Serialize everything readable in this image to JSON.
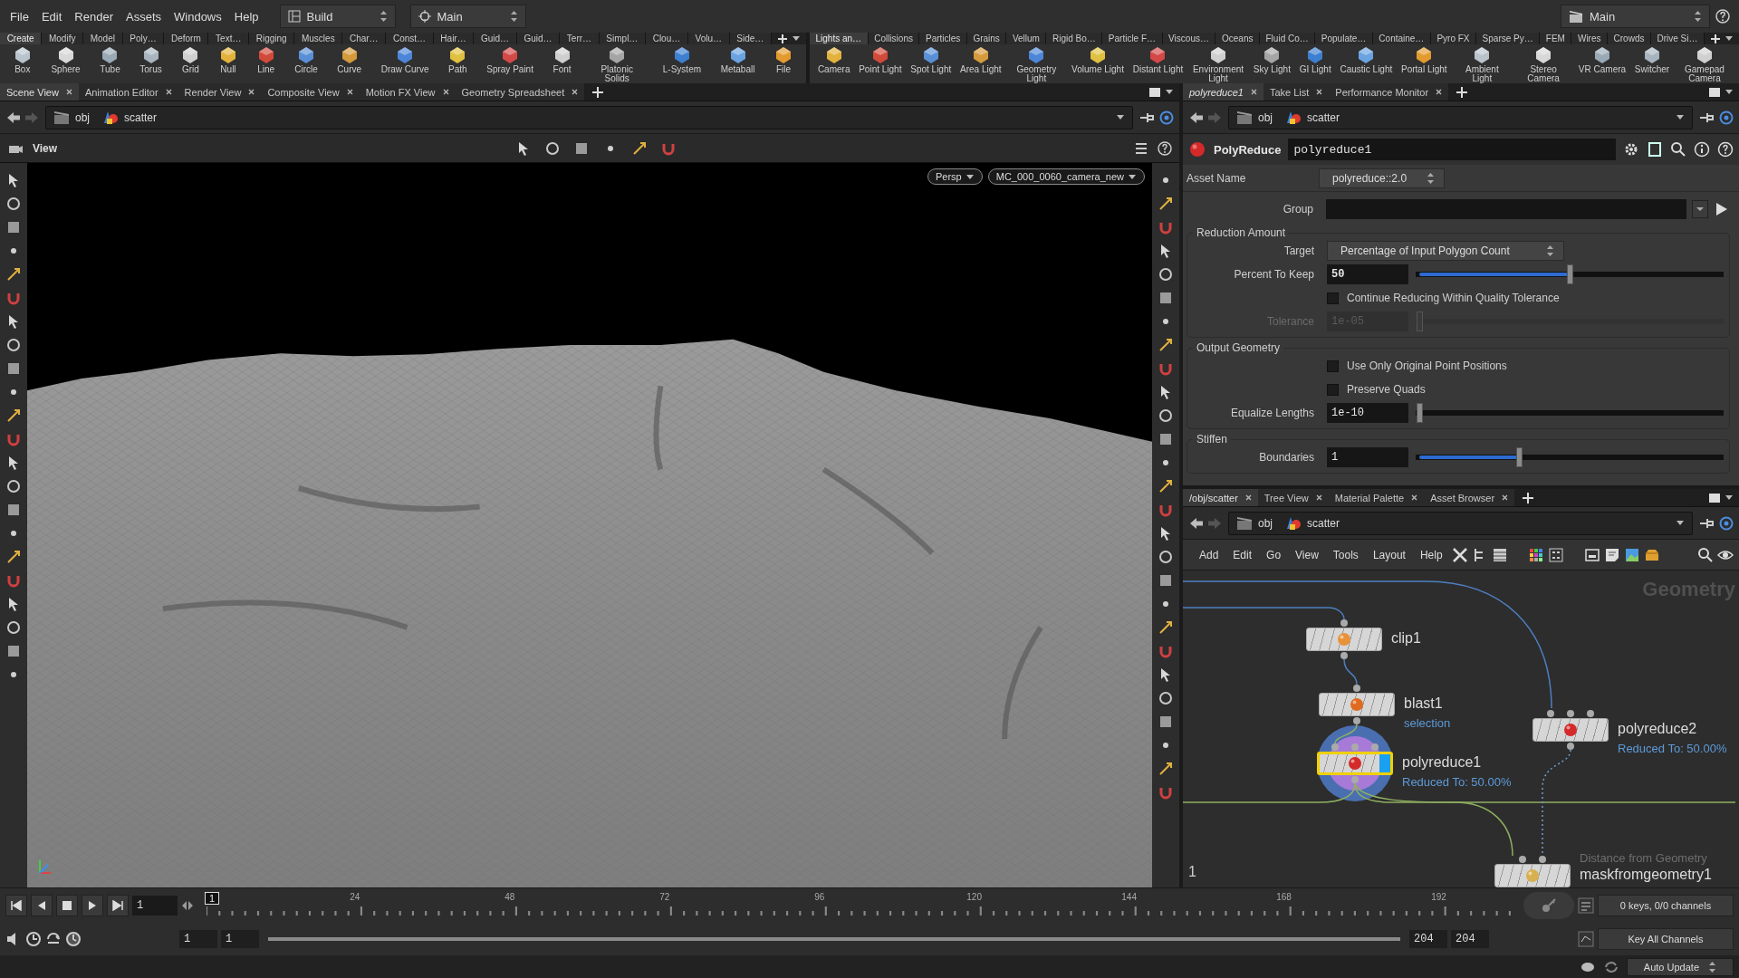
{
  "menu_bar": {
    "items": [
      "File",
      "Edit",
      "Render",
      "Assets",
      "Windows",
      "Help"
    ],
    "desktops": [
      "Build",
      "Main"
    ],
    "right_desktop": "Main"
  },
  "shelves": [
    {
      "tabs": [
        {
          "label": "Create",
          "selected": true
        },
        {
          "label": "Modify",
          "selected": false
        },
        {
          "label": "Model",
          "selected": false
        },
        {
          "label": "Poly…",
          "selected": false
        },
        {
          "label": "Deform",
          "selected": false
        },
        {
          "label": "Text…",
          "selected": false
        },
        {
          "label": "Rigging",
          "selected": false
        },
        {
          "label": "Muscles",
          "selected": false
        },
        {
          "label": "Char…",
          "selected": false
        },
        {
          "label": "Const…",
          "selected": false
        },
        {
          "label": "Hair…",
          "selected": false
        },
        {
          "label": "Guid…",
          "selected": false
        },
        {
          "label": "Guid…",
          "selected": false
        },
        {
          "label": "Terr…",
          "selected": false
        },
        {
          "label": "Simpl…",
          "selected": false
        },
        {
          "label": "Clou…",
          "selected": false
        },
        {
          "label": "Volu…",
          "selected": false
        },
        {
          "label": "Side…",
          "selected": false
        }
      ],
      "tools": [
        "Box",
        "Sphere",
        "Tube",
        "Torus",
        "Grid",
        "Null",
        "Line",
        "Circle",
        "Curve",
        "Draw Curve",
        "Path",
        "Spray Paint",
        "Font",
        "Platonic Solids",
        "L-System",
        "Metaball",
        "File"
      ]
    },
    {
      "tabs": [
        {
          "label": "Lights an…",
          "selected": true
        },
        {
          "label": "Collisions",
          "selected": false
        },
        {
          "label": "Particles",
          "selected": false
        },
        {
          "label": "Grains",
          "selected": false
        },
        {
          "label": "Vellum",
          "selected": false
        },
        {
          "label": "Rigid Bo…",
          "selected": false
        },
        {
          "label": "Particle F…",
          "selected": false
        },
        {
          "label": "Viscous…",
          "selected": false
        },
        {
          "label": "Oceans",
          "selected": false
        },
        {
          "label": "Fluid Co…",
          "selected": false
        },
        {
          "label": "Populate…",
          "selected": false
        },
        {
          "label": "Containe…",
          "selected": false
        },
        {
          "label": "Pyro FX",
          "selected": false
        },
        {
          "label": "Sparse Py…",
          "selected": false
        },
        {
          "label": "FEM",
          "selected": false
        },
        {
          "label": "Wires",
          "selected": false
        },
        {
          "label": "Crowds",
          "selected": false
        },
        {
          "label": "Drive Si…",
          "selected": false
        }
      ],
      "tools": [
        "Camera",
        "Point Light",
        "Spot Light",
        "Area Light",
        "Geometry Light",
        "Volume Light",
        "Distant Light",
        "Environment Light",
        "Sky Light",
        "GI Light",
        "Caustic Light",
        "Portal Light",
        "Ambient Light",
        "Stereo Camera",
        "VR Camera",
        "Switcher",
        "Gamepad Camera"
      ]
    }
  ],
  "scene_pane": {
    "tabs": [
      {
        "label": "Scene View",
        "selected": true
      },
      {
        "label": "Animation Editor",
        "selected": false
      },
      {
        "label": "Render View",
        "selected": false
      },
      {
        "label": "Composite View",
        "selected": false
      },
      {
        "label": "Motion FX View",
        "selected": false
      },
      {
        "label": "Geometry Spreadsheet",
        "selected": false
      }
    ],
    "path": [
      "obj",
      "scatter"
    ],
    "viewer_label": "View",
    "view_menus": [
      "Persp",
      "MC_000_0060_camera_new"
    ]
  },
  "parameter_pane": {
    "tabs": [
      {
        "label": "polyreduce1",
        "selected": true
      },
      {
        "label": "Take List",
        "selected": false
      },
      {
        "label": "Performance Monitor",
        "selected": false
      }
    ],
    "path": [
      "obj",
      "scatter"
    ],
    "node_type": "PolyReduce",
    "node_name": "polyreduce1",
    "asset_label": "Asset Name",
    "asset_value": "polyreduce::2.0",
    "group_label": "Group",
    "sections": [
      {
        "title": "Reduction Amount",
        "rows": [
          {
            "kind": "menu",
            "label": "Target",
            "value": "Percentage of Input Polygon Count",
            "disabled": false
          },
          {
            "kind": "slider",
            "label": "Percent To Keep",
            "value": "50",
            "level": 0.5,
            "disabled": false
          },
          {
            "kind": "checkbox",
            "label": "Continue Reducing Within Quality Tolerance",
            "checked": false,
            "disabled": false
          },
          {
            "kind": "slider",
            "label": "Tolerance",
            "value": "1e-05",
            "level": 0,
            "disabled": true
          }
        ]
      },
      {
        "title": "Output Geometry",
        "rows": [
          {
            "kind": "checkbox",
            "label": "Use Only Original Point Positions",
            "checked": false,
            "disabled": false
          },
          {
            "kind": "checkbox",
            "label": "Preserve Quads",
            "checked": false,
            "disabled": false
          },
          {
            "kind": "slider",
            "label": "Equalize Lengths",
            "value": "1e-10",
            "level": 0,
            "disabled": false
          }
        ]
      },
      {
        "title": "Stiffen",
        "rows": [
          {
            "kind": "slider",
            "label": "Boundaries",
            "value": "1",
            "level": 0.33,
            "disabled": false
          }
        ]
      }
    ]
  },
  "network_pane": {
    "tabs": [
      {
        "label": "/obj/scatter",
        "selected": true
      },
      {
        "label": "Tree View",
        "selected": false
      },
      {
        "label": "Material Palette",
        "selected": false
      },
      {
        "label": "Asset Browser",
        "selected": false
      }
    ],
    "path": [
      "obj",
      "scatter"
    ],
    "menu": [
      "Add",
      "Edit",
      "Go",
      "View",
      "Tools",
      "Layout",
      "Help"
    ],
    "context_label": "Geometry",
    "nodes": [
      {
        "name": "clip1",
        "selected": false
      },
      {
        "name": "blast1",
        "comment": "selection",
        "selected": false
      },
      {
        "name": "polyreduce1",
        "comment": "Reduced To: 50.00%",
        "selected": true
      },
      {
        "name": "polyreduce2",
        "comment": "Reduced To: 50.00%",
        "selected": false
      },
      {
        "name": "maskfromgeometry1",
        "description": "Distance from Geometry",
        "selected": false
      }
    ],
    "corner_label": "1"
  },
  "timeline": {
    "frame": "1",
    "current_frame": "1",
    "ruler_labels": [
      "24",
      "48",
      "72",
      "96",
      "120",
      "144",
      "168",
      "192"
    ],
    "range_start": [
      "1",
      "1"
    ],
    "range_end": [
      "204",
      "204"
    ],
    "playback_range": {
      "level": 1
    },
    "keys_info": "0 keys, 0/0 channels",
    "key_button": "Key All Channels"
  },
  "status_bar": {
    "auto_update": "Auto Update"
  }
}
